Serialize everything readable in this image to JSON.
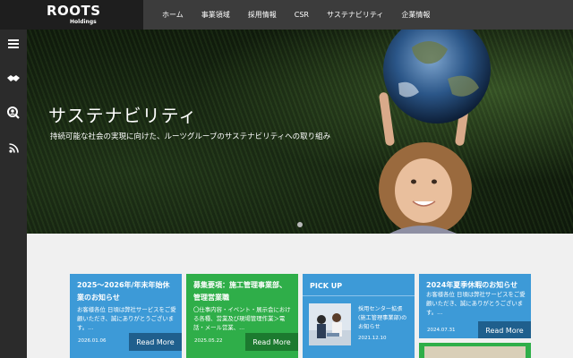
{
  "brand": {
    "logo": "ROOTS",
    "sub": "Holdings"
  },
  "nav": [
    "ホーム",
    "事業領域",
    "採用情報",
    "CSR",
    "サステナビリティ",
    "企業情報"
  ],
  "sidebar_icons": [
    "menu-icon",
    "handshake-icon",
    "search-person-icon",
    "rss-icon"
  ],
  "hero": {
    "title": "サステナビリティ",
    "subtitle": "持続可能な社会の実現に向けた、ルーツグループのサステナビリティへの取り組み"
  },
  "cards": [
    {
      "title": "2025～2026年/年末年始休業のお知らせ",
      "text": "お客様各位 日頃は弊社サービスをご愛顧いただき、誠にありがとうございます。...",
      "date": "2026.01.06",
      "more": "Read More",
      "color": "#3d9ad7"
    },
    {
      "title": "募集要項：施工管理事業部、管理営業職",
      "text": "〇仕事内容・イベント・展示会における各種、営業及び現場管理作業＞電話・メール営業、...",
      "date": "2025.05.22",
      "more": "Read More",
      "color": "#2fae49"
    },
    {
      "title": "PICK UP",
      "text": "採用センター拡張(施工管理事業部)のお知らせ",
      "date": "2021.12.10",
      "more": "",
      "color": "#3d9ad7"
    },
    {
      "title": "2024年夏季休暇のお知らせ",
      "text": "お客様各位 日頃は弊社サービスをご愛顧いただき、誠にありがとうございます。...",
      "date": "2024.07.31",
      "more": "Read More",
      "color": "#3d9ad7"
    }
  ]
}
